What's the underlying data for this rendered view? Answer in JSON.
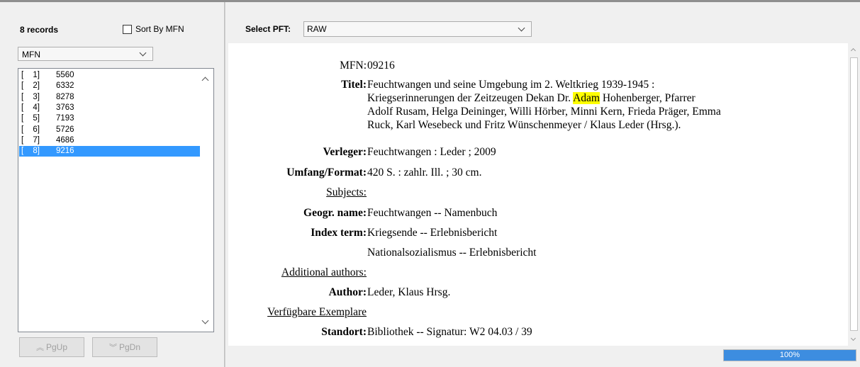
{
  "left": {
    "records_count": "8 records",
    "sort_label": "Sort By MFN",
    "sort_checked": false,
    "sort_field_select": "MFN",
    "records": [
      {
        "bracket": "[",
        "index": "1]",
        "value": "5560"
      },
      {
        "bracket": "[",
        "index": "2]",
        "value": "6332"
      },
      {
        "bracket": "[",
        "index": "3]",
        "value": "8278"
      },
      {
        "bracket": "[",
        "index": "4]",
        "value": "3763"
      },
      {
        "bracket": "[",
        "index": "5]",
        "value": "7193"
      },
      {
        "bracket": "[",
        "index": "6]",
        "value": "5726"
      },
      {
        "bracket": "[",
        "index": "7]",
        "value": "4686"
      },
      {
        "bracket": "[",
        "index": "8]",
        "value": "9216"
      }
    ],
    "selected_record": 8,
    "pgup_label": "PgUp",
    "pgdn_label": "PgDn"
  },
  "right": {
    "pft_label": "Select PFT:",
    "pft_value": "RAW",
    "record": {
      "mfn_label": "MFN:",
      "mfn_value": "09216",
      "titel_label": "Titel:",
      "titel_line1": "Feuchtwangen und seine Umgebung im 2. Weltkrieg 1939-1945 :",
      "titel_line2_pre": "Kriegserinnerungen der Zeitzeugen Dekan Dr. ",
      "titel_highlight": "Adam",
      "titel_line2_post": " Hohenberger, Pfarrer",
      "titel_line3": "Adolf Rusam, Helga Deininger, Willi Hörber, Minni Kern, Frieda Präger, Emma",
      "titel_line4": "Ruck, Karl Wesebeck und Fritz Wünschenmeyer / Klaus Leder (Hrsg.).",
      "verleger_label": "Verleger:",
      "verleger_value": "Feuchtwangen : Leder ; 2009",
      "umfang_label": "Umfang/Format:",
      "umfang_value": "420 S. : zahlr. Ill. ; 30 cm.",
      "subjects_label": "Subjects:",
      "geogr_label": "Geogr. name:",
      "geogr_value": "Feuchtwangen -- Namenbuch",
      "index_label": "Index term:",
      "index_value1": "Kriegsende -- Erlebnisbericht",
      "index_value2": "Nationalsozialismus -- Erlebnisbericht",
      "additional_label": "Additional authors:",
      "author_label": "Author:",
      "author_value": "Leder, Klaus Hrsg.",
      "exemplare_label": "Verfügbare Exemplare",
      "standort_label": "Standort:",
      "standort_value": "Bibliothek -- Signatur: W2 04.03 / 39"
    },
    "progress_text": "100%",
    "progress_value": 1.0
  },
  "colors": {
    "selection": "#3399ff",
    "highlight": "#ffff00",
    "progress": "#3d8de0"
  }
}
